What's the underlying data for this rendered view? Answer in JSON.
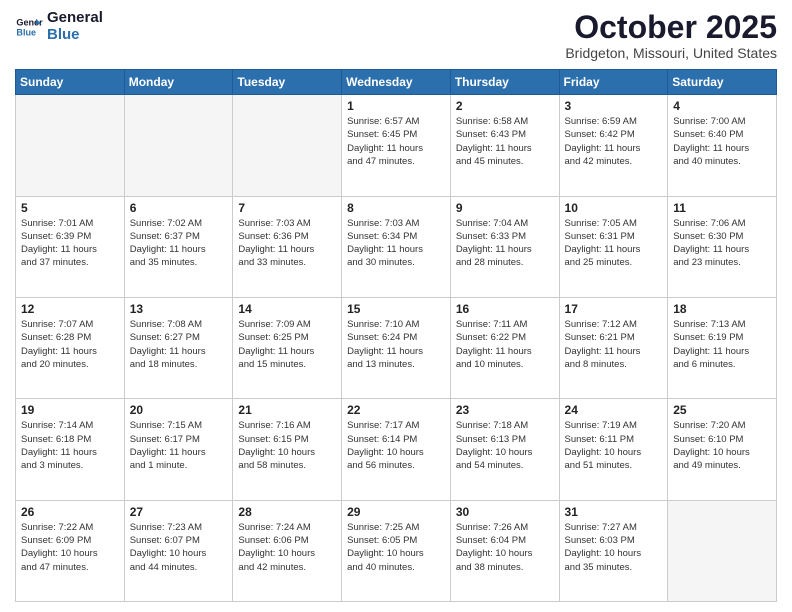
{
  "logo": {
    "line1": "General",
    "line2": "Blue"
  },
  "title": "October 2025",
  "location": "Bridgeton, Missouri, United States",
  "days_of_week": [
    "Sunday",
    "Monday",
    "Tuesday",
    "Wednesday",
    "Thursday",
    "Friday",
    "Saturday"
  ],
  "weeks": [
    [
      {
        "day": "",
        "info": ""
      },
      {
        "day": "",
        "info": ""
      },
      {
        "day": "",
        "info": ""
      },
      {
        "day": "1",
        "info": "Sunrise: 6:57 AM\nSunset: 6:45 PM\nDaylight: 11 hours\nand 47 minutes."
      },
      {
        "day": "2",
        "info": "Sunrise: 6:58 AM\nSunset: 6:43 PM\nDaylight: 11 hours\nand 45 minutes."
      },
      {
        "day": "3",
        "info": "Sunrise: 6:59 AM\nSunset: 6:42 PM\nDaylight: 11 hours\nand 42 minutes."
      },
      {
        "day": "4",
        "info": "Sunrise: 7:00 AM\nSunset: 6:40 PM\nDaylight: 11 hours\nand 40 minutes."
      }
    ],
    [
      {
        "day": "5",
        "info": "Sunrise: 7:01 AM\nSunset: 6:39 PM\nDaylight: 11 hours\nand 37 minutes."
      },
      {
        "day": "6",
        "info": "Sunrise: 7:02 AM\nSunset: 6:37 PM\nDaylight: 11 hours\nand 35 minutes."
      },
      {
        "day": "7",
        "info": "Sunrise: 7:03 AM\nSunset: 6:36 PM\nDaylight: 11 hours\nand 33 minutes."
      },
      {
        "day": "8",
        "info": "Sunrise: 7:03 AM\nSunset: 6:34 PM\nDaylight: 11 hours\nand 30 minutes."
      },
      {
        "day": "9",
        "info": "Sunrise: 7:04 AM\nSunset: 6:33 PM\nDaylight: 11 hours\nand 28 minutes."
      },
      {
        "day": "10",
        "info": "Sunrise: 7:05 AM\nSunset: 6:31 PM\nDaylight: 11 hours\nand 25 minutes."
      },
      {
        "day": "11",
        "info": "Sunrise: 7:06 AM\nSunset: 6:30 PM\nDaylight: 11 hours\nand 23 minutes."
      }
    ],
    [
      {
        "day": "12",
        "info": "Sunrise: 7:07 AM\nSunset: 6:28 PM\nDaylight: 11 hours\nand 20 minutes."
      },
      {
        "day": "13",
        "info": "Sunrise: 7:08 AM\nSunset: 6:27 PM\nDaylight: 11 hours\nand 18 minutes."
      },
      {
        "day": "14",
        "info": "Sunrise: 7:09 AM\nSunset: 6:25 PM\nDaylight: 11 hours\nand 15 minutes."
      },
      {
        "day": "15",
        "info": "Sunrise: 7:10 AM\nSunset: 6:24 PM\nDaylight: 11 hours\nand 13 minutes."
      },
      {
        "day": "16",
        "info": "Sunrise: 7:11 AM\nSunset: 6:22 PM\nDaylight: 11 hours\nand 10 minutes."
      },
      {
        "day": "17",
        "info": "Sunrise: 7:12 AM\nSunset: 6:21 PM\nDaylight: 11 hours\nand 8 minutes."
      },
      {
        "day": "18",
        "info": "Sunrise: 7:13 AM\nSunset: 6:19 PM\nDaylight: 11 hours\nand 6 minutes."
      }
    ],
    [
      {
        "day": "19",
        "info": "Sunrise: 7:14 AM\nSunset: 6:18 PM\nDaylight: 11 hours\nand 3 minutes."
      },
      {
        "day": "20",
        "info": "Sunrise: 7:15 AM\nSunset: 6:17 PM\nDaylight: 11 hours\nand 1 minute."
      },
      {
        "day": "21",
        "info": "Sunrise: 7:16 AM\nSunset: 6:15 PM\nDaylight: 10 hours\nand 58 minutes."
      },
      {
        "day": "22",
        "info": "Sunrise: 7:17 AM\nSunset: 6:14 PM\nDaylight: 10 hours\nand 56 minutes."
      },
      {
        "day": "23",
        "info": "Sunrise: 7:18 AM\nSunset: 6:13 PM\nDaylight: 10 hours\nand 54 minutes."
      },
      {
        "day": "24",
        "info": "Sunrise: 7:19 AM\nSunset: 6:11 PM\nDaylight: 10 hours\nand 51 minutes."
      },
      {
        "day": "25",
        "info": "Sunrise: 7:20 AM\nSunset: 6:10 PM\nDaylight: 10 hours\nand 49 minutes."
      }
    ],
    [
      {
        "day": "26",
        "info": "Sunrise: 7:22 AM\nSunset: 6:09 PM\nDaylight: 10 hours\nand 47 minutes."
      },
      {
        "day": "27",
        "info": "Sunrise: 7:23 AM\nSunset: 6:07 PM\nDaylight: 10 hours\nand 44 minutes."
      },
      {
        "day": "28",
        "info": "Sunrise: 7:24 AM\nSunset: 6:06 PM\nDaylight: 10 hours\nand 42 minutes."
      },
      {
        "day": "29",
        "info": "Sunrise: 7:25 AM\nSunset: 6:05 PM\nDaylight: 10 hours\nand 40 minutes."
      },
      {
        "day": "30",
        "info": "Sunrise: 7:26 AM\nSunset: 6:04 PM\nDaylight: 10 hours\nand 38 minutes."
      },
      {
        "day": "31",
        "info": "Sunrise: 7:27 AM\nSunset: 6:03 PM\nDaylight: 10 hours\nand 35 minutes."
      },
      {
        "day": "",
        "info": ""
      }
    ]
  ]
}
